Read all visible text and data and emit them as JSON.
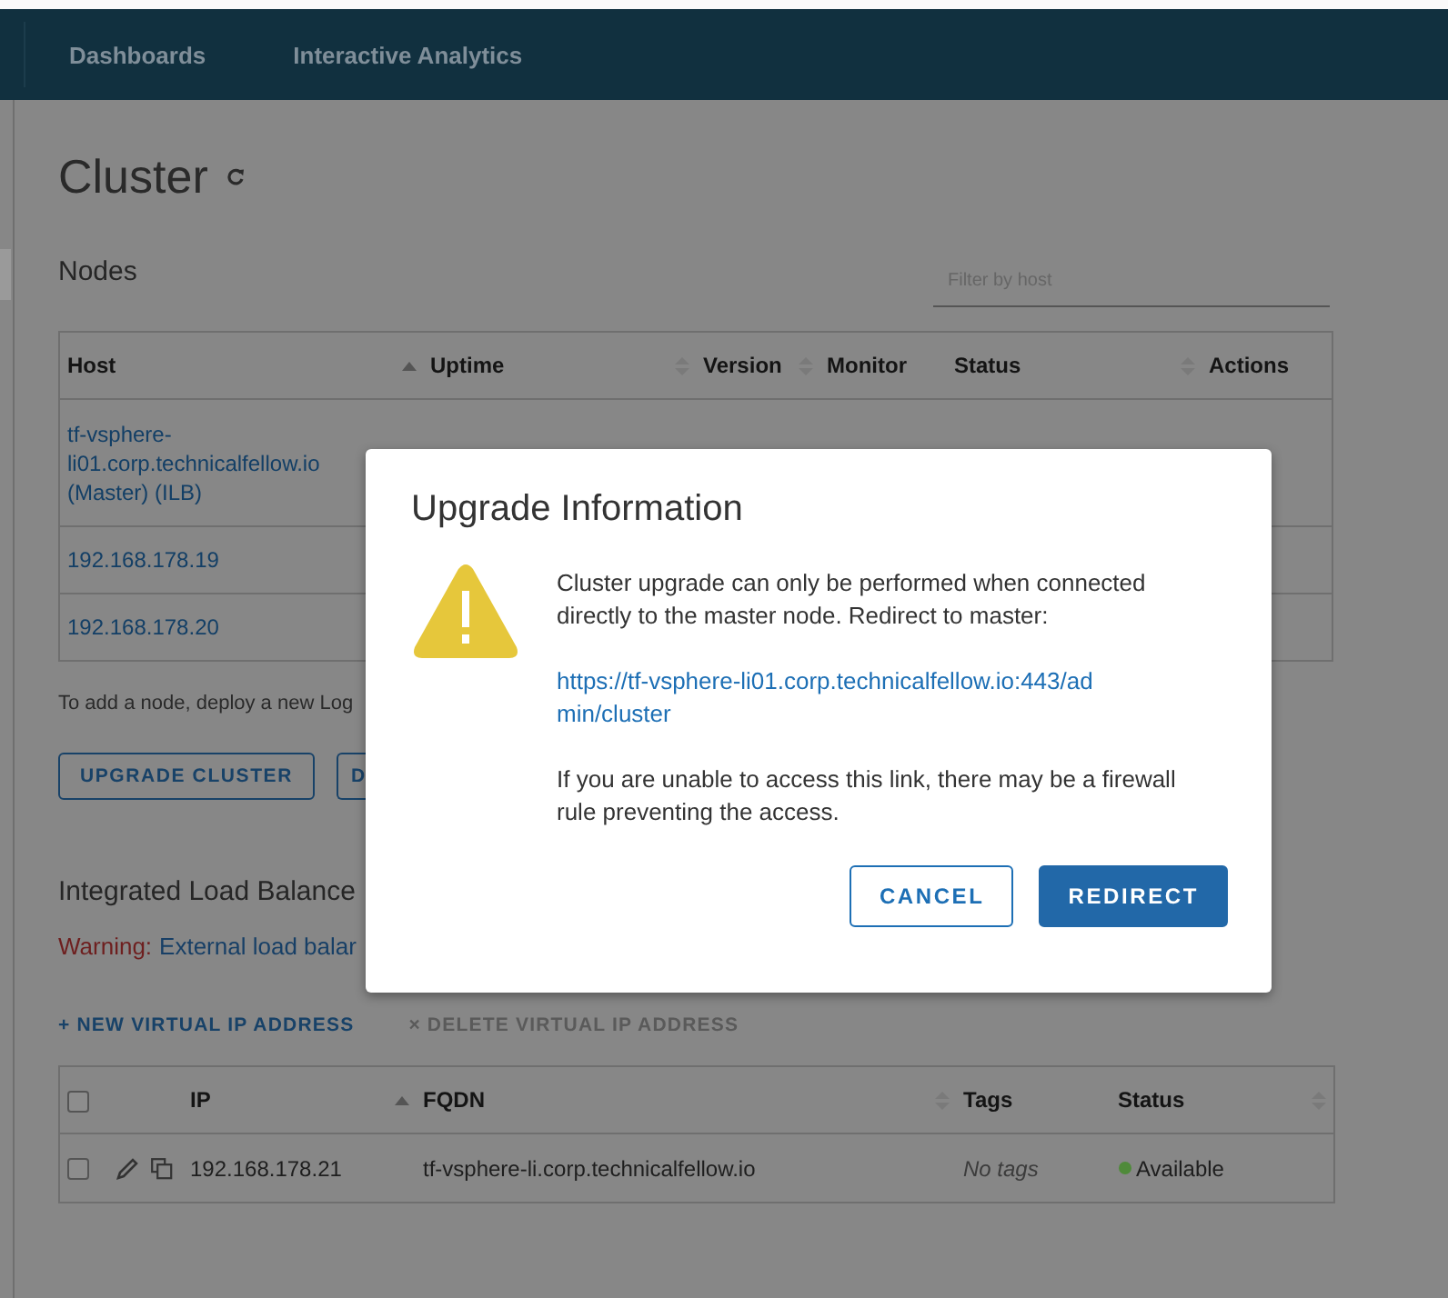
{
  "nav": {
    "items": [
      {
        "label": "Dashboards"
      },
      {
        "label": "Interactive Analytics"
      }
    ]
  },
  "page": {
    "title": "Cluster"
  },
  "nodes": {
    "heading": "Nodes",
    "filter": {
      "placeholder": "Filter by host"
    },
    "columns": [
      {
        "label": "Host",
        "sortable": true,
        "sorted": true
      },
      {
        "label": "Uptime",
        "sortable": true,
        "sorted": false
      },
      {
        "label": "Version",
        "sortable": true,
        "sorted": false
      },
      {
        "label": "Monitor",
        "sortable": false
      },
      {
        "label": "Status",
        "sortable": true,
        "sorted": false
      },
      {
        "label": "Actions",
        "sortable": false
      }
    ],
    "rows": [
      {
        "host": "tf-vsphere-li01.corp.technicalfellow.io (Master) (ILB)"
      },
      {
        "host": "192.168.178.19"
      },
      {
        "host": "192.168.178.20"
      }
    ],
    "note": "To add a node, deploy a new Log",
    "buttons": [
      "UPGRADE CLUSTER",
      "D"
    ]
  },
  "ilb": {
    "heading": "Integrated Load Balance",
    "warning_label": "Warning:",
    "warning_text": "External load balar"
  },
  "vip": {
    "actions": [
      {
        "label": "+ NEW VIRTUAL IP ADDRESS",
        "disabled": false
      },
      {
        "label": "× DELETE VIRTUAL IP ADDRESS",
        "disabled": true
      }
    ],
    "select_all": {
      "checked": false
    },
    "columns": [
      {
        "label": "IP",
        "sortable": true,
        "sorted": true
      },
      {
        "label": "FQDN",
        "sortable": true,
        "sorted": false
      },
      {
        "label": "Tags",
        "sortable": false
      },
      {
        "label": "Status",
        "sortable": true,
        "sorted": false
      }
    ],
    "rows": [
      {
        "checked": false,
        "ip": "192.168.178.21",
        "fqdn": "tf-vsphere-li.corp.technicalfellow.io",
        "tags": "No tags",
        "status": "Available",
        "color": "#4f8a3a"
      }
    ]
  },
  "modal": {
    "title": "Upgrade Information",
    "message": "Cluster upgrade can only be performed when connected directly to the master node. Redirect to master:",
    "link": "https://tf-vsphere-li01.corp.technicalfellow.io:443/admin/cluster",
    "note": "If you are unable to access this link, there may be a firewall rule preventing the access.",
    "buttons": [
      {
        "label": "CANCEL",
        "kind": "secondary"
      },
      {
        "label": "REDIRECT",
        "kind": "primary"
      }
    ]
  }
}
